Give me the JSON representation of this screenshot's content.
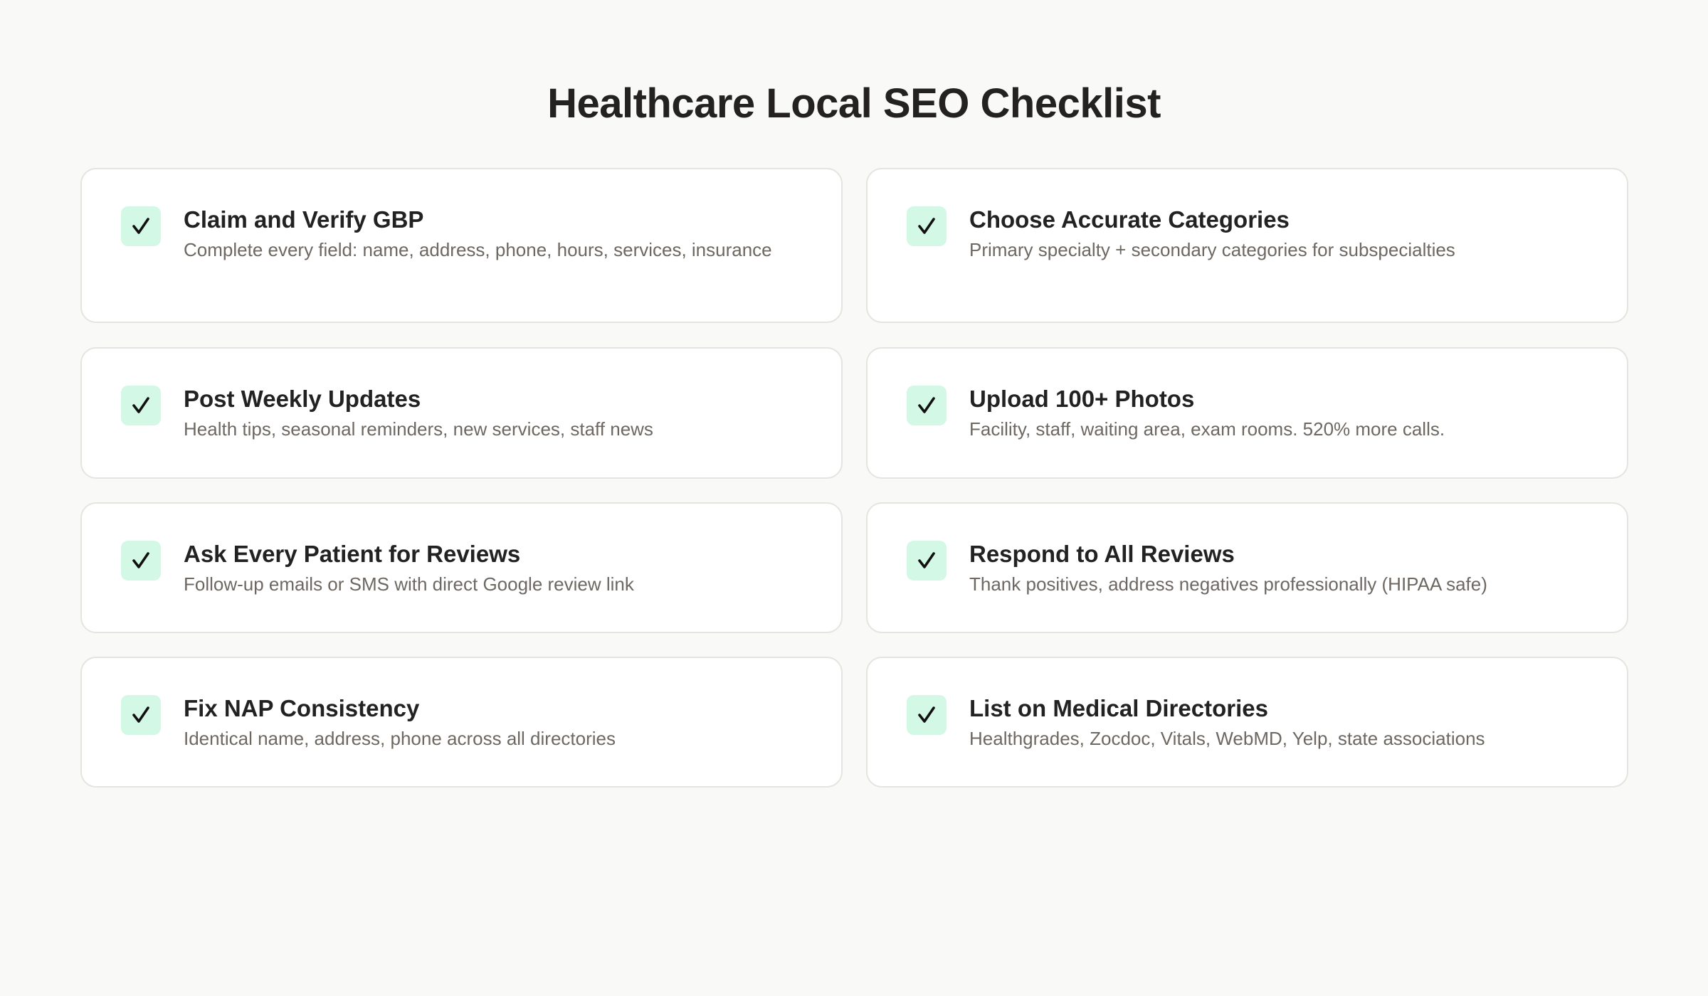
{
  "title": "Healthcare Local SEO Checklist",
  "colors": {
    "background": "#f9f9f7",
    "card_background": "#ffffff",
    "card_border": "#e4e4e0",
    "check_background": "#d3f8e6",
    "check_mark": "#111111",
    "title_text": "#242220",
    "description_text": "#6e6862"
  },
  "checklist": {
    "items": [
      {
        "icon": "check-icon",
        "title": "Claim and Verify GBP",
        "description": "Complete every field: name, address, phone, hours, services, insurance"
      },
      {
        "icon": "check-icon",
        "title": "Choose Accurate Categories",
        "description": "Primary specialty + secondary categories for subspecialties"
      },
      {
        "icon": "check-icon",
        "title": "Post Weekly Updates",
        "description": "Health tips, seasonal reminders, new services, staff news"
      },
      {
        "icon": "check-icon",
        "title": "Upload 100+ Photos",
        "description": "Facility, staff, waiting area, exam rooms. 520% more calls."
      },
      {
        "icon": "check-icon",
        "title": "Ask Every Patient for Reviews",
        "description": "Follow-up emails or SMS with direct Google review link"
      },
      {
        "icon": "check-icon",
        "title": "Respond to All Reviews",
        "description": "Thank positives, address negatives professionally (HIPAA safe)"
      },
      {
        "icon": "check-icon",
        "title": "Fix NAP Consistency",
        "description": "Identical name, address, phone across all directories"
      },
      {
        "icon": "check-icon",
        "title": "List on Medical Directories",
        "description": "Healthgrades, Zocdoc, Vitals, WebMD, Yelp, state associations"
      }
    ]
  }
}
